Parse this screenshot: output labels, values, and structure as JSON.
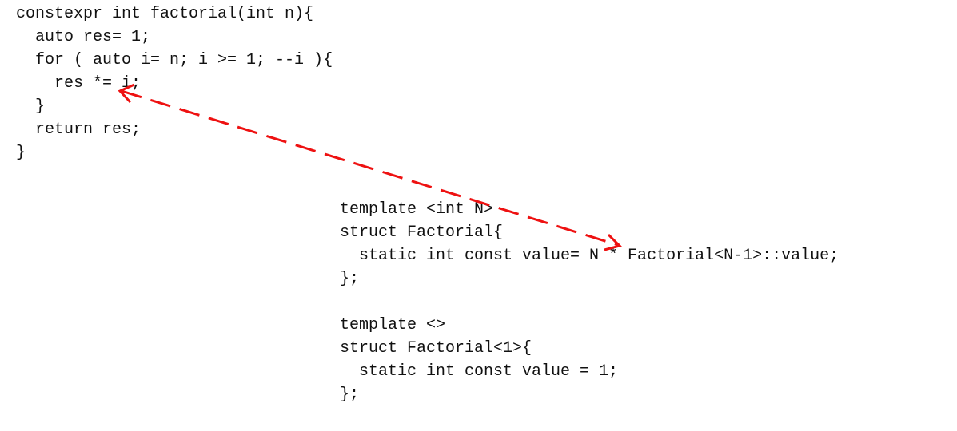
{
  "constexpr_function": {
    "lines": [
      "constexpr int factorial(int n){",
      "  auto res= 1;",
      "  for ( auto i= n; i >= 1; --i ){",
      "    res *= i;",
      "  }",
      "  return res;",
      "}"
    ]
  },
  "template_primary": {
    "lines": [
      "template <int N>",
      "struct Factorial{",
      "  static int const value= N * Factorial<N-1>::value;",
      "};"
    ]
  },
  "template_specialization": {
    "lines": [
      "template <>",
      "struct Factorial<1>{",
      "  static int const value = 1;",
      "};"
    ]
  },
  "arrow": {
    "color": "#ee1111",
    "style": "dashed",
    "heads": "both",
    "connects": [
      "res *= i;",
      "value= N * Factorial<N-1>::value;"
    ]
  }
}
